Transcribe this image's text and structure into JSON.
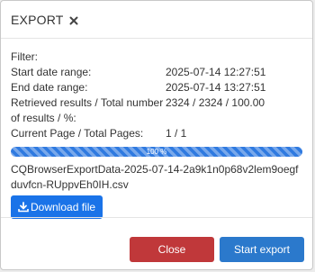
{
  "dialog": {
    "title": "EXPORT",
    "close_icon": "close-icon"
  },
  "filter_label": "Filter:",
  "details": [
    {
      "label": "Start date range:",
      "value": "2025-07-14 12:27:51"
    },
    {
      "label": "End date range:",
      "value": "2025-07-14 13:27:51"
    },
    {
      "label": "Retrieved results / Total number of results / %:",
      "value": "2324 / 2324 / 100.00"
    },
    {
      "label": "Current Page / Total Pages:",
      "value": "1 / 1"
    }
  ],
  "progress": {
    "percent": 100,
    "label": "100 %",
    "color": "#2f7ae0"
  },
  "file": {
    "name": "CQBrowserExportData-2025-07-14-2a9k1n0p68v2lem9oegfduvfcn-RUppvEh0IH.csv",
    "download_label": "Download file",
    "download_icon": "download-icon"
  },
  "footer": {
    "close_label": "Close",
    "start_label": "Start export",
    "close_color": "#c0383a",
    "start_color": "#2b79cc"
  }
}
